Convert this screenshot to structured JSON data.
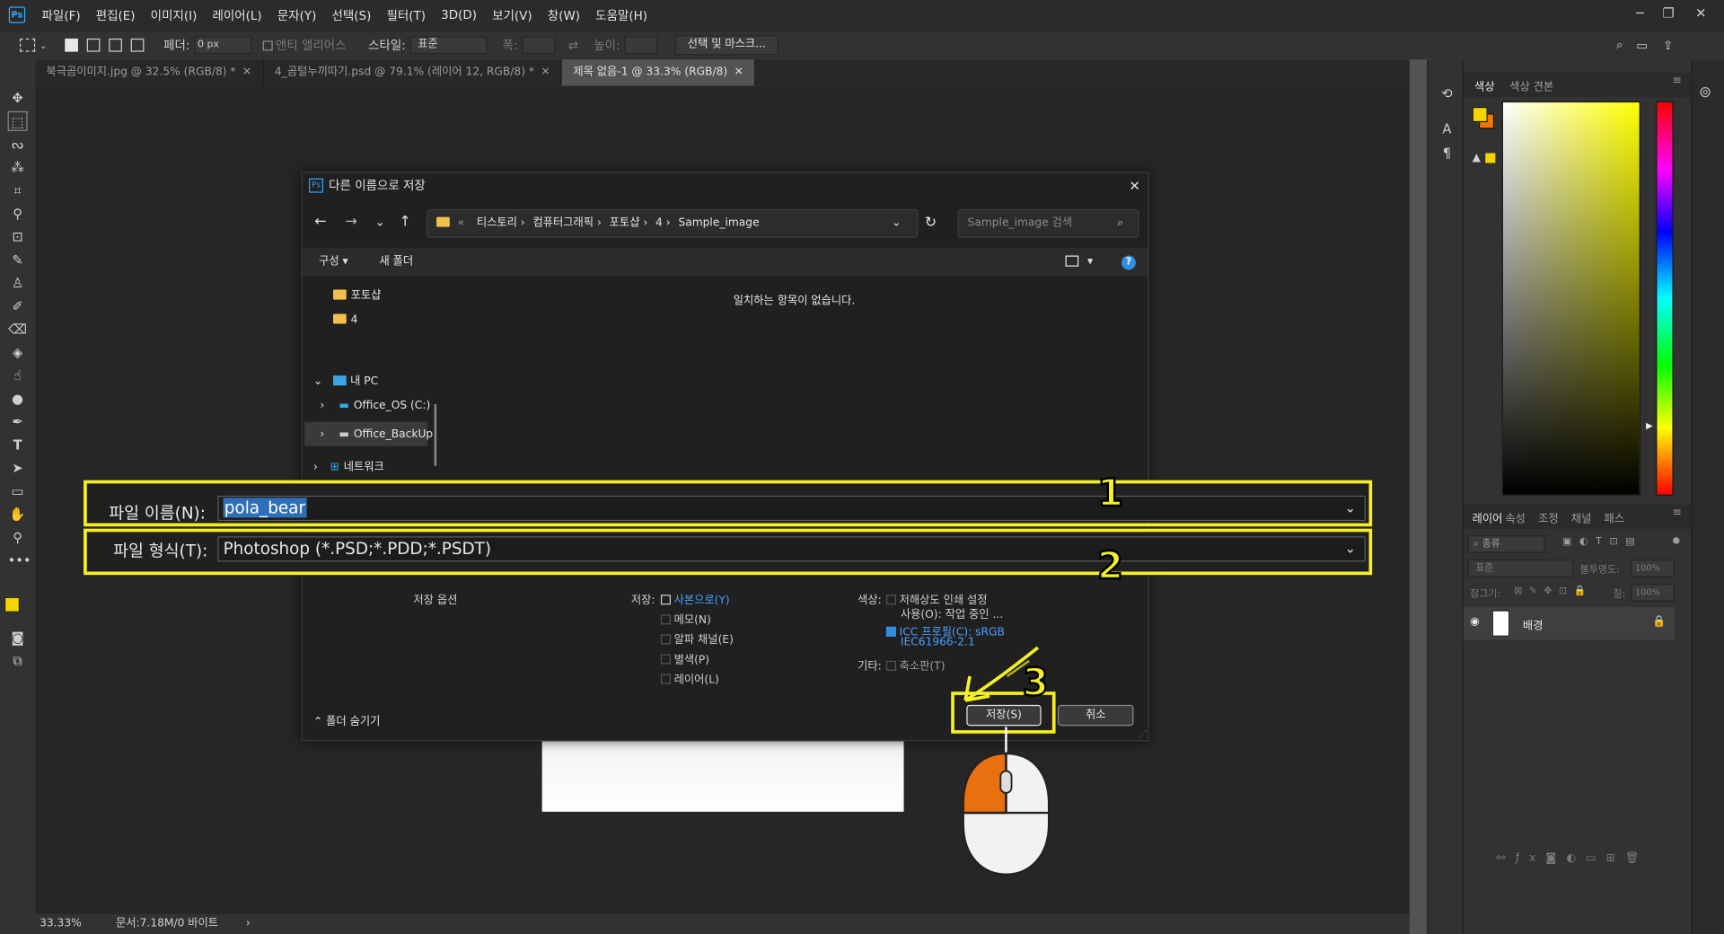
{
  "app": {
    "logo": "Ps",
    "menus": [
      "파일(F)",
      "편집(E)",
      "이미지(I)",
      "레이어(L)",
      "문자(Y)",
      "선택(S)",
      "필터(T)",
      "3D(D)",
      "보기(V)",
      "창(W)",
      "도움말(H)"
    ]
  },
  "options_bar": {
    "feather_label": "페더:",
    "feather_value": "0 px",
    "antialias_label": "앤티 앨리어스",
    "style_label": "스타일:",
    "style_value": "표준",
    "width_label": "폭:",
    "height_label": "높이:",
    "select_mask_button": "선택 및 마스크..."
  },
  "tabs": [
    {
      "label": "북극곰이미지.jpg @ 32.5% (RGB/8) *"
    },
    {
      "label": "4_곰털누끼따기.psd @ 79.1% (레이어 12, RGB/8) *"
    },
    {
      "label": "제목 없음-1 @ 33.3% (RGB/8)"
    }
  ],
  "status": {
    "zoom": "33.33%",
    "doc": "문서:7.18M/0 바이트"
  },
  "panels": {
    "color_tabs": [
      "색상",
      "색상 견본"
    ],
    "layer_tabs": [
      "레이어",
      "속성",
      "조정",
      "채널",
      "패스"
    ],
    "kind": "종류",
    "blend_mode": "표준",
    "opacity_label": "불투명도:",
    "opacity_value": "100%",
    "lock_label": "잠그기:",
    "fill_label": "칠:",
    "fill_value": "100%",
    "layer_name": "배경",
    "fg_color": "#f5d400",
    "bg_color": "#f07800"
  },
  "dialog": {
    "title": "다른 이름으로 저장",
    "breadcrumb": [
      "티스토리",
      "컴퓨터그래픽",
      "포토샵",
      "4",
      "Sample_image"
    ],
    "search_placeholder": "Sample_image 검색",
    "organize": "구성",
    "new_folder": "새 폴더",
    "nav": {
      "photoshop": "포토샵",
      "four": "4",
      "my_pc": "내 PC",
      "office_os": "Office_OS (C:)",
      "office_backup": "Office_BackUp",
      "network": "네트워크"
    },
    "empty_message": "일치하는 항목이 없습니다.",
    "file_name_label": "파일 이름(N):",
    "file_name_value": "pola_bear",
    "file_type_label": "파일 형식(T):",
    "file_type_value": "Photoshop (*.PSD;*.PDD;*.PSDT)",
    "save_options": "저장 옵션",
    "save_label": "저장:",
    "save_opts": [
      "사본으로(Y)",
      "메모(N)",
      "알파 채널(E)",
      "별색(P)",
      "레이어(L)"
    ],
    "color_label": "색상:",
    "color_opt1a": "저해상도 인쇄 설정",
    "color_opt1b": "사용(O): 작업 중인 ...",
    "icc_label": "ICC 프로필(C):  sRGB",
    "icc_value": "IEC61966-2.1",
    "other_label": "기타:",
    "thumbnail": "축소판(T)",
    "hide_folders": "폴더 숨기기",
    "save_button": "저장(S)",
    "cancel_button": "취소"
  },
  "annotations": {
    "one": "1",
    "two": "2",
    "three": "3"
  }
}
